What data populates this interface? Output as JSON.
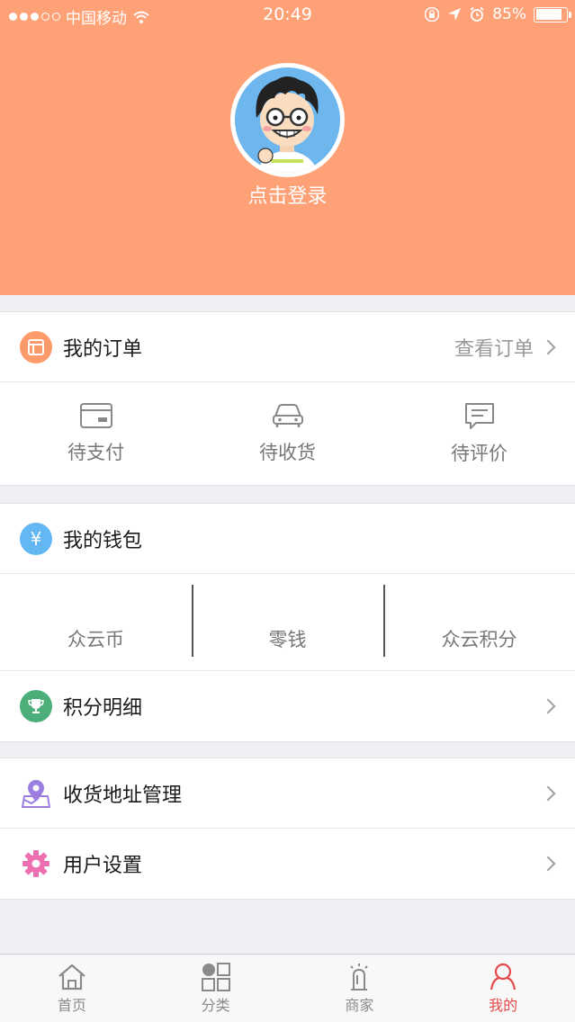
{
  "status_bar": {
    "carrier": "中国移动",
    "time": "20:49",
    "battery_text": "85%",
    "battery_level": 0.85
  },
  "profile": {
    "login_label": "点击登录"
  },
  "orders": {
    "title": "我的订单",
    "view_all": "查看订单",
    "items": [
      {
        "label": "待支付",
        "icon": "card-icon"
      },
      {
        "label": "待收货",
        "icon": "car-icon"
      },
      {
        "label": "待评价",
        "icon": "comment-icon"
      }
    ]
  },
  "wallet": {
    "title": "我的钱包",
    "icon_glyph": "¥",
    "items": [
      {
        "label": "众云币"
      },
      {
        "label": "零钱"
      },
      {
        "label": "众云积分"
      }
    ]
  },
  "points": {
    "title": "积分明细"
  },
  "menu": {
    "address": "收货地址管理",
    "settings": "用户设置"
  },
  "tabbar": {
    "items": [
      {
        "label": "首页",
        "icon": "home-icon"
      },
      {
        "label": "分类",
        "icon": "category-icon"
      },
      {
        "label": "商家",
        "icon": "merchant-icon"
      },
      {
        "label": "我的",
        "icon": "profile-icon",
        "active": true
      }
    ]
  },
  "colors": {
    "header": "#ffa176",
    "orders_icon": "#ff9a6a",
    "wallet_icon": "#63b8f4",
    "points_icon": "#4caf7a",
    "address_icon": "#9b7ee0",
    "settings_icon": "#ee6fb0",
    "active_tab": "#e44a4a"
  }
}
